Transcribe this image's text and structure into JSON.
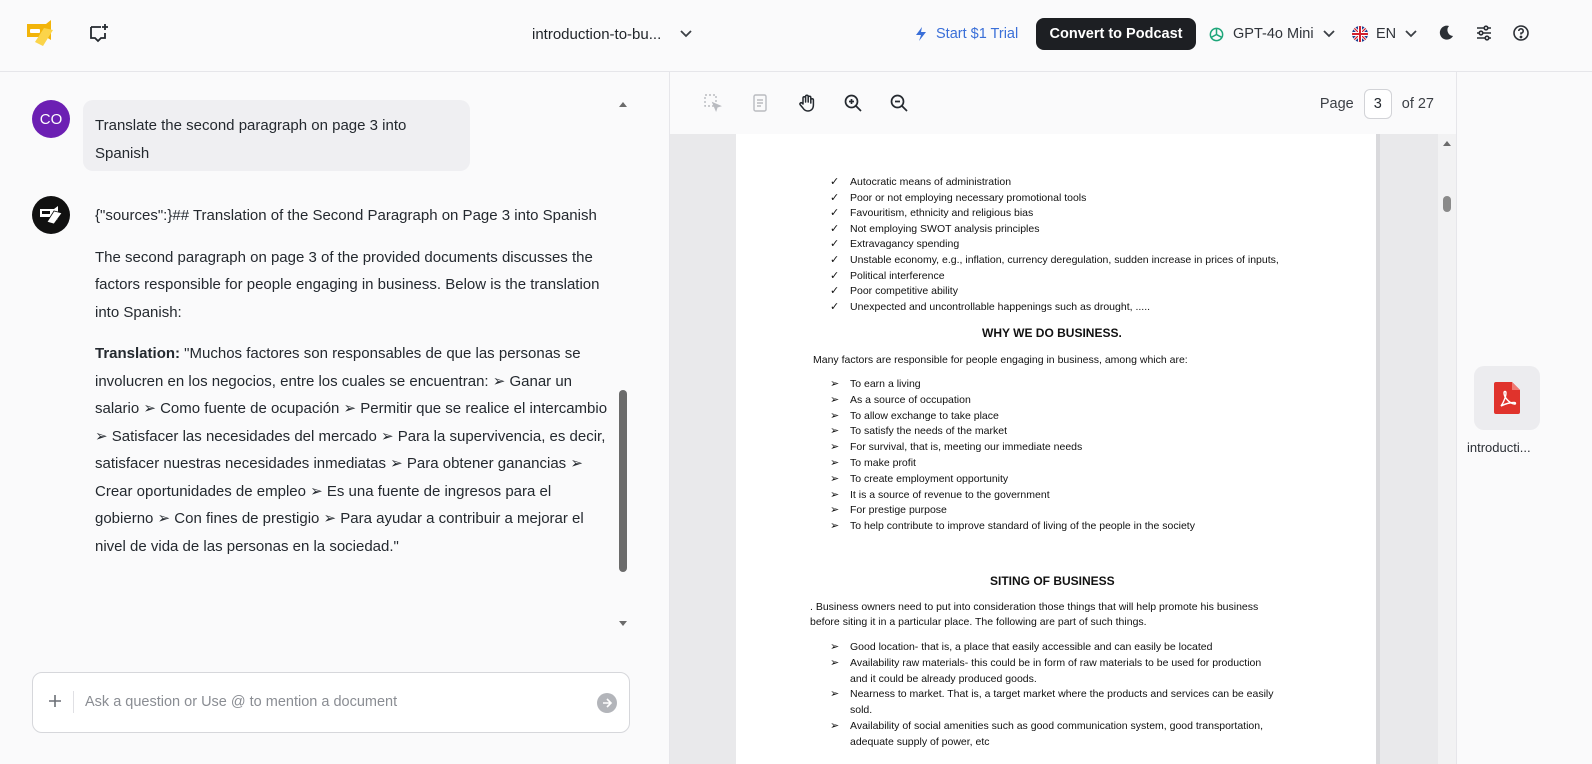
{
  "topbar": {
    "document_name": "introduction-to-bu...",
    "trial_label": "Start $1 Trial",
    "convert_label": "Convert to Podcast",
    "model_label": "GPT-4o Mini",
    "language_label": "EN",
    "colors": {
      "accent": "#3a6fd8",
      "convert_bg": "#1d1f23",
      "logo": "#f2b40a"
    }
  },
  "chat": {
    "user_initials": "CO",
    "user_message": "Translate the second paragraph on page 3 into Spanish",
    "answer_heading": "{\"sources\":}## Translation of the Second Paragraph on Page 3 into Spanish",
    "answer_intro": "The second paragraph on page 3 of the provided documents discusses the factors responsible for people engaging in business. Below is the translation into Spanish:",
    "translation_label": "Translation:",
    "translation_text": " \"Muchos factores son responsables de que las personas se involucren en los negocios, entre los cuales se encuentran: ➢ Ganar un salario ➢ Como fuente de ocupación ➢ Permitir que se realice el intercambio ➢ Satisfacer las necesidades del mercado ➢ Para la supervivencia, es decir, satisfacer nuestras necesidades inmediatas ➢ Para obtener ganancias ➢ Crear oportunidades de empleo ➢ Es una fuente de ingresos para el gobierno ➢ Con fines de prestigio ➢ Para ayudar a contribuir a mejorar el nivel de vida de las personas en la sociedad.\"",
    "input_placeholder": "Ask a question or Use @ to mention a document"
  },
  "viewer": {
    "page_label": "Page",
    "current_page": "3",
    "total_pages": "of 27",
    "checklist": [
      "Autocratic means of administration",
      "Poor or not employing necessary promotional tools",
      "Favouritism, ethnicity and religious bias",
      "Not employing SWOT analysis principles",
      "Extravagancy spending",
      "Unstable economy, e.g., inflation, currency deregulation, sudden increase in prices of inputs,",
      "Political interference",
      "Poor competitive ability",
      "Unexpected and uncontrollable happenings such as drought, ....."
    ],
    "section1_heading": "WHY WE DO BUSINESS.",
    "section1_intro": "Many factors are responsible for people engaging in business, among which are:",
    "section1_items": [
      "To earn a living",
      "As a source of occupation",
      "To allow exchange to take place",
      "To satisfy the needs of the market",
      " For survival, that is, meeting our immediate needs",
      "To make profit",
      "To create employment opportunity",
      "It is a source of revenue to the government",
      "For prestige purpose",
      "To help contribute to improve standard of living of the people in the society"
    ],
    "section2_heading": "SITING OF BUSINESS",
    "section2_intro_1": ". Business owners need to put into consideration those things that will help promote his business",
    "section2_intro_2": "before siting it in a particular place. The following are part of such things.",
    "section2_items": [
      "Good location- that is, a place that easily accessible and can easily be located",
      "Availability raw materials- this could be in form of raw materials to be used for production",
      "and it could be already produced goods.",
      "Nearness to market. That is, a target market where the products and services can be easily",
      "sold.",
      "Availability of social amenities such as good communication system, good transportation,",
      "adequate supply of power, etc"
    ]
  },
  "rail": {
    "document_label": "introducti..."
  }
}
